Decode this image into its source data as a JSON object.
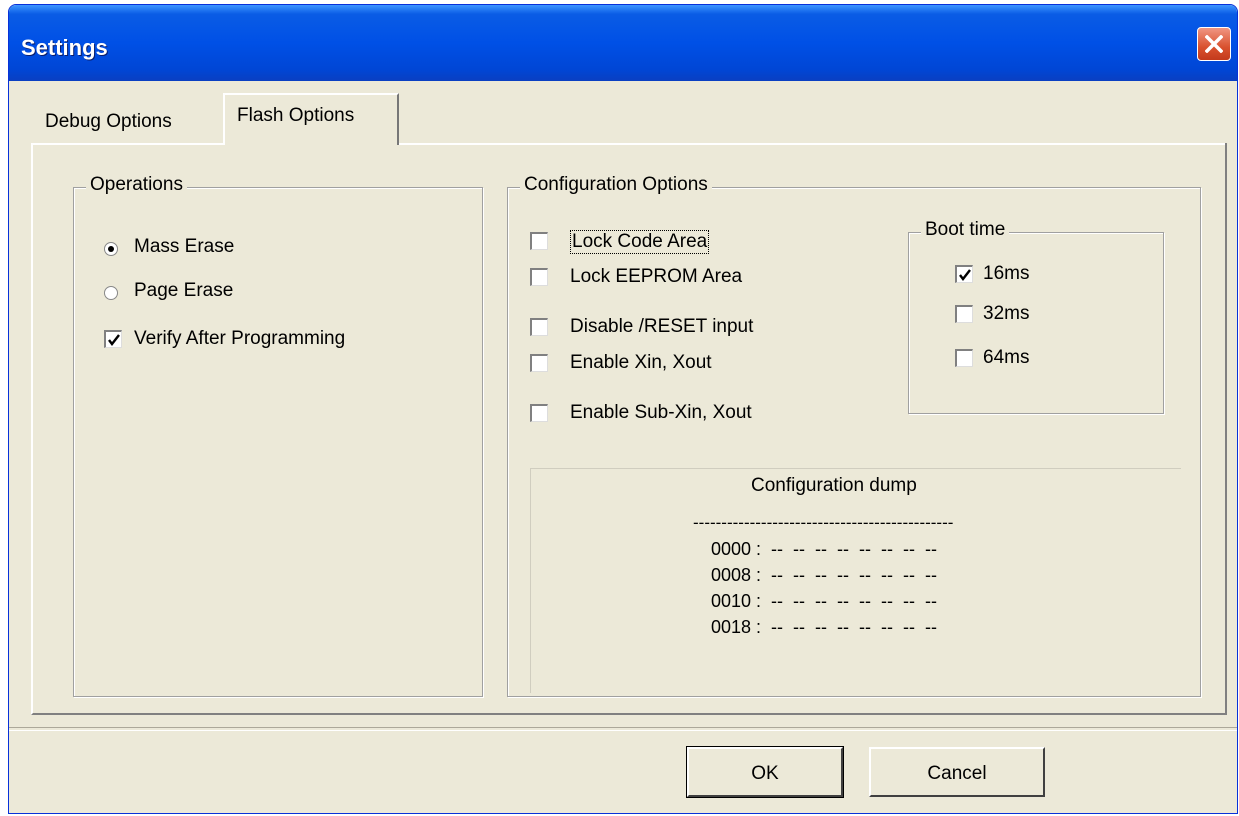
{
  "window": {
    "title": "Settings"
  },
  "tabs": [
    {
      "label": "Debug Options",
      "active": false
    },
    {
      "label": "Flash Options",
      "active": true
    }
  ],
  "operations": {
    "legend": "Operations",
    "mass_erase": {
      "label": "Mass Erase",
      "selected": true
    },
    "page_erase": {
      "label": "Page Erase",
      "selected": false
    },
    "verify": {
      "label": "Verify After Programming",
      "checked": true
    }
  },
  "config": {
    "legend": "Configuration Options",
    "options": [
      {
        "label": "Lock Code Area",
        "checked": false
      },
      {
        "label": "Lock EEPROM Area",
        "checked": false
      },
      {
        "label": "Disable /RESET input",
        "checked": false
      },
      {
        "label": "Enable Xin, Xout",
        "checked": false
      },
      {
        "label": "Enable Sub-Xin, Xout",
        "checked": false
      }
    ],
    "boot": {
      "legend": "Boot time",
      "options": [
        {
          "label": "16ms",
          "checked": true
        },
        {
          "label": "32ms",
          "checked": false
        },
        {
          "label": "64ms",
          "checked": false
        }
      ]
    },
    "dump": {
      "title": "Configuration dump",
      "separator": "----------------------------------------------",
      "rows": [
        "0000 :  --  --  --  --  --  --  --  --",
        "0008 :  --  --  --  --  --  --  --  --",
        "0010 :  --  --  --  --  --  --  --  --",
        "0018 :  --  --  --  --  --  --  --  --"
      ]
    }
  },
  "buttons": {
    "ok": "OK",
    "cancel": "Cancel"
  }
}
